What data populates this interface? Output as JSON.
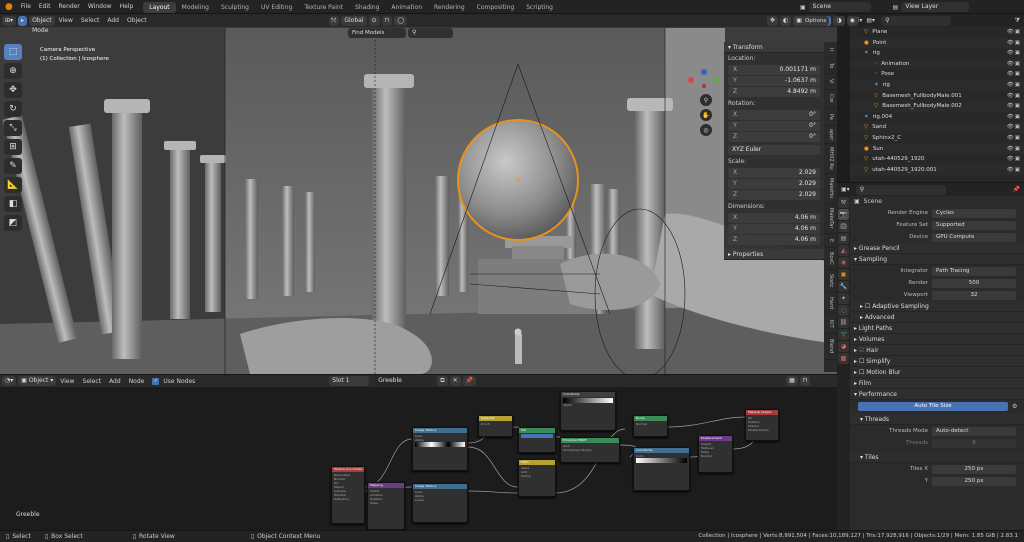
{
  "menu": [
    "File",
    "Edit",
    "Render",
    "Window",
    "Help"
  ],
  "workspaces": [
    "Layout",
    "Modeling",
    "Sculpting",
    "UV Editing",
    "Texture Paint",
    "Shading",
    "Animation",
    "Rendering",
    "Compositing",
    "Scripting"
  ],
  "active_workspace": "Layout",
  "scene_name": "Scene",
  "view_layer": "View Layer",
  "viewport": {
    "mode": "Object Mode",
    "menus": [
      "View",
      "Select",
      "Add",
      "Object"
    ],
    "orientation": "Global",
    "find_models": "Find Models",
    "options": "Options",
    "overlay_title": "Camera Perspective",
    "overlay_sub": "(1) Collection | Icosphere"
  },
  "npanel": {
    "transform": "Transform",
    "location": "Location:",
    "loc": [
      {
        "ax": "X",
        "v": "0.001171 m"
      },
      {
        "ax": "Y",
        "v": "-1.0637 m"
      },
      {
        "ax": "Z",
        "v": "4.8492 m"
      }
    ],
    "rotation": "Rotation:",
    "rot": [
      {
        "ax": "X",
        "v": "0°"
      },
      {
        "ax": "Y",
        "v": "0°"
      },
      {
        "ax": "Z",
        "v": "0°"
      }
    ],
    "rot_mode": "XYZ Euler",
    "scale": "Scale:",
    "scl": [
      {
        "ax": "X",
        "v": "2.029"
      },
      {
        "ax": "Y",
        "v": "2.029"
      },
      {
        "ax": "Z",
        "v": "2.029"
      }
    ],
    "dimensions": "Dimensions:",
    "dim": [
      {
        "ax": "X",
        "v": "4.06 m"
      },
      {
        "ax": "Y",
        "v": "4.06 m"
      },
      {
        "ax": "Z",
        "v": "4.06 m"
      }
    ],
    "properties": "Properties"
  },
  "side_tabs": [
    "It",
    "To",
    "Vi",
    "Cre",
    "Pa",
    "aper",
    "MHX2 Ru",
    "MakeHu",
    "MakeTar",
    "E",
    "BoxC",
    "Sketc",
    "Hard",
    "KIT",
    "Blend"
  ],
  "node_editor": {
    "type": "Object",
    "menus": [
      "View",
      "Select",
      "Add",
      "Node"
    ],
    "use_nodes": "Use Nodes",
    "slot": "Slot 1",
    "material": "Greeble",
    "label": "Greeble"
  },
  "outliner": [
    {
      "name": "Plane",
      "indent": 1,
      "icon": "▽"
    },
    {
      "name": "Point",
      "indent": 1,
      "icon": "●"
    },
    {
      "name": "rig",
      "indent": 1,
      "icon": "✶"
    },
    {
      "name": "Animation",
      "indent": 2,
      "icon": "◦"
    },
    {
      "name": "Pose",
      "indent": 2,
      "icon": "◦"
    },
    {
      "name": "rig",
      "indent": 2,
      "icon": "✶"
    },
    {
      "name": "Basemesh_FullbodyMale.001",
      "indent": 2,
      "icon": "▽"
    },
    {
      "name": "Basemesh_FullbodyMale.002",
      "indent": 2,
      "icon": "▽"
    },
    {
      "name": "rig.004",
      "indent": 1,
      "icon": "✶"
    },
    {
      "name": "Sand",
      "indent": 1,
      "icon": "▽"
    },
    {
      "name": "Sphinx2_C",
      "indent": 1,
      "icon": "▽"
    },
    {
      "name": "Sun",
      "indent": 1,
      "icon": "●"
    },
    {
      "name": "utah-440529_1920",
      "indent": 1,
      "icon": "▽"
    },
    {
      "name": "utah-440529_1920.001",
      "indent": 1,
      "icon": "▽"
    }
  ],
  "properties": {
    "scene": "Scene",
    "render_engine_label": "Render Engine",
    "render_engine": "Cycles",
    "feature_set_label": "Feature Set",
    "feature_set": "Supported",
    "device_label": "Device",
    "device": "GPU Compute",
    "grease_pencil": "Grease Pencil",
    "sampling": "Sampling",
    "integrator_label": "Integrator",
    "integrator": "Path Tracing",
    "render_label": "Render",
    "render": "500",
    "viewport_label": "Viewport",
    "viewport": "32",
    "adaptive_sampling": "Adaptive Sampling",
    "advanced": "Advanced",
    "light_paths": "Light Paths",
    "volumes": "Volumes",
    "hair": "Hair",
    "simplify": "Simplify",
    "motion_blur": "Motion Blur",
    "film": "Film",
    "performance": "Performance",
    "auto_tile": "Auto Tile Size",
    "threads": "Threads",
    "threads_mode_label": "Threads Mode",
    "threads_mode": "Auto-detect",
    "threads_label": "Threads",
    "threads_val": "8",
    "tiles": "Tiles",
    "tiles_x_label": "Tiles X",
    "tiles_x": "250 px",
    "tiles_y_label": "Y",
    "tiles_y": "250 px"
  },
  "status": {
    "select": "Select",
    "box_select": "Box Select",
    "rotate_view": "Rotate View",
    "context_menu": "Object Context Menu",
    "stats": "Collection | Icosphere | Verts:8,991,504 | Faces:10,189,127 | Tris:17,928,916 | Objects:1/29 | Mem: 1.85 GiB | 2.83.1"
  },
  "colors": {
    "accent": "#4772b3",
    "selection": "#e8921b",
    "header": "#232323"
  }
}
